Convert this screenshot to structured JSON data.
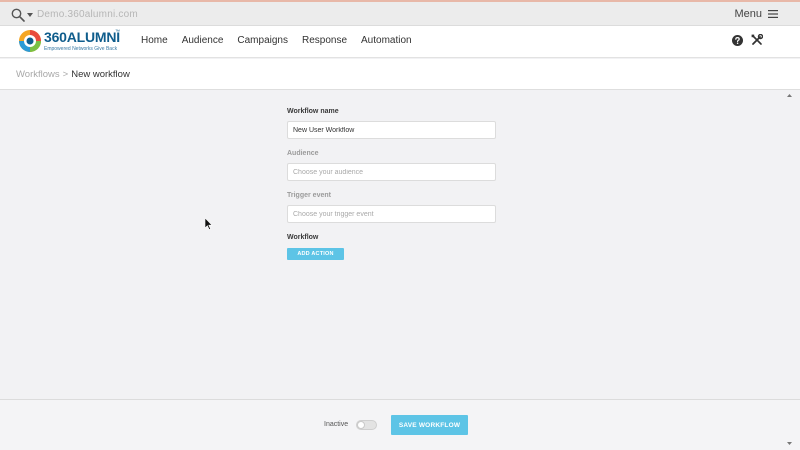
{
  "topbar": {
    "site_url": "Demo.360alumni.com",
    "menu_label": "Menu",
    "icons": [
      "search-icon",
      "chevron-down-icon",
      "hamburger-icon"
    ]
  },
  "navbar": {
    "logo": {
      "text": "360ALUMNI",
      "tagline": "Empowered Networks Give Back"
    },
    "links": [
      "Home",
      "Audience",
      "Campaigns",
      "Response",
      "Automation"
    ],
    "icons": [
      "help-icon",
      "tools-icon"
    ]
  },
  "breadcrumb": {
    "parent": "Workflows",
    "separator": ">",
    "current": "New workflow"
  },
  "form": {
    "name": {
      "label": "Workflow name",
      "value": "New User Workflow"
    },
    "audience": {
      "label": "Audience",
      "placeholder": "Choose your audience"
    },
    "trigger": {
      "label": "Trigger event",
      "placeholder": "Choose your trigger event"
    },
    "workflow": {
      "label": "Workflow",
      "add_action": "ADD ACTION"
    }
  },
  "footer": {
    "status_label": "Inactive",
    "active": false,
    "save_label": "SAVE WORKFLOW"
  },
  "colors": {
    "accent": "#5dc4e6",
    "brand": "#0f5d8c",
    "background": "#f2f2f4"
  }
}
